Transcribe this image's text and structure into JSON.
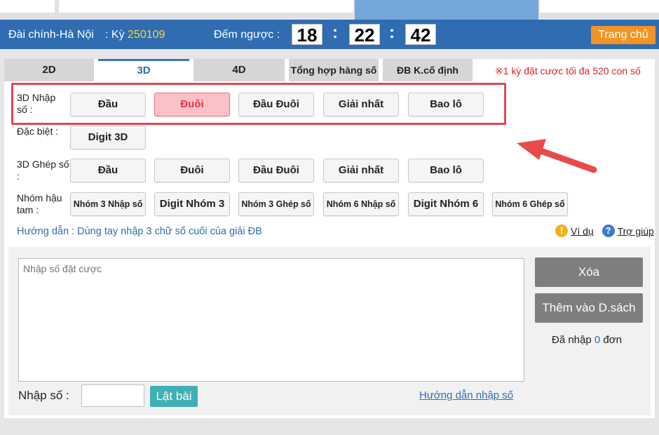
{
  "header": {
    "station": "Đài chính-Hà Nội",
    "ky_label": ": Kỳ",
    "ky_value": "250109",
    "countdown_label": "Đếm ngược :",
    "countdown": [
      "18",
      "22",
      "42"
    ],
    "colon": ":",
    "home_button": "Trang chủ"
  },
  "tabs": [
    "2D",
    "3D",
    "4D",
    "Tổng hợp hàng số",
    "ĐB K.cố định"
  ],
  "active_tab": "3D",
  "notice": "※1 kỳ đặt cược tối đa 520 con số",
  "rows": [
    {
      "label": "3D Nhập số :",
      "buttons": [
        "Đầu",
        "Đuôi",
        "Đầu Đuôi",
        "Giải nhất",
        "Bao lô"
      ],
      "selected": "Đuôi"
    },
    {
      "label": "Đặc biệt :",
      "buttons": [
        "Digit 3D"
      ]
    },
    {
      "label": "3D Ghép số :",
      "buttons": [
        "Đầu",
        "Đuôi",
        "Đầu Đuôi",
        "Giải nhất",
        "Bao lô"
      ]
    },
    {
      "label": "Nhóm hậu tam :",
      "buttons": [
        "Nhóm 3 Nhập số",
        "Digit Nhóm 3",
        "Nhóm 3 Ghép số",
        "Nhóm 6 Nhập số",
        "Digit Nhóm 6",
        "Nhóm 6 Ghép số"
      ]
    }
  ],
  "guide": "Hướng dẫn : Dùng tay nhập 3 chữ số cuối của giải ĐB",
  "help": {
    "example": "Ví dụ",
    "support": "Trợ giúp"
  },
  "input": {
    "placeholder": "Nhập số đặt cược",
    "delete_button": "Xóa",
    "add_button": "Thêm vào D.sách",
    "count_prefix": "Đã nhập",
    "count_value": "0",
    "count_suffix": "đơn",
    "number_label": "Nhập số :",
    "flip_button": "Lật bài",
    "guide_link": "Hướng dẫn nhập số"
  },
  "colors": {
    "header_bg": "#2f6cb1",
    "home_button": "#f29423",
    "selected_bg": "#f8c2c7",
    "highlight": "#e6464f",
    "flip_button": "#3fb0b5"
  }
}
